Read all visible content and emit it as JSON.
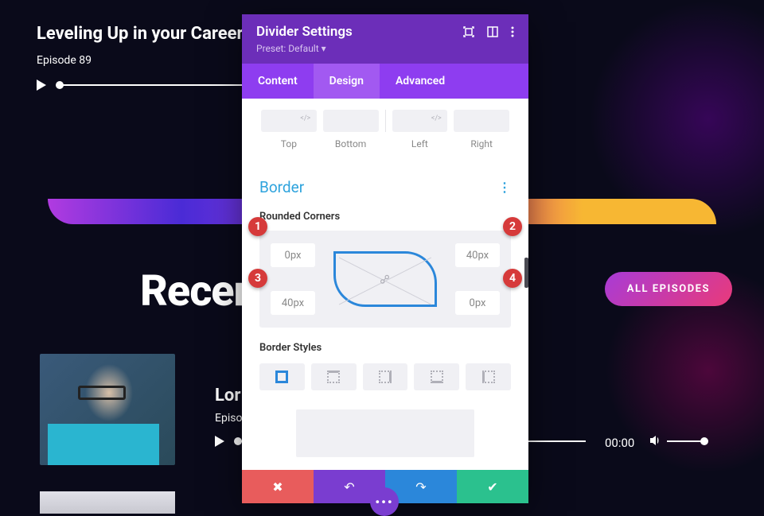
{
  "page": {
    "title": "Leveling Up in your Career, w",
    "episode": "Episode 89",
    "recent_heading": "Recent",
    "all_episodes_label": "ALL EPISODES",
    "ep2_title": "Lor",
    "ep2_sub": "Episo",
    "time": "00:00"
  },
  "modal": {
    "title": "Divider Settings",
    "preset": "Preset: Default ▾",
    "tabs": {
      "content": "Content",
      "design": "Design",
      "advanced": "Advanced"
    },
    "spacing": {
      "top": "Top",
      "bottom": "Bottom",
      "left": "Left",
      "right": "Right"
    },
    "border": {
      "section": "Border",
      "rounded_label": "Rounded Corners",
      "tl": "0px",
      "tr": "40px",
      "bl": "40px",
      "br": "0px",
      "styles_label": "Border Styles"
    }
  },
  "callouts": {
    "c1": "1",
    "c2": "2",
    "c3": "3",
    "c4": "4"
  }
}
